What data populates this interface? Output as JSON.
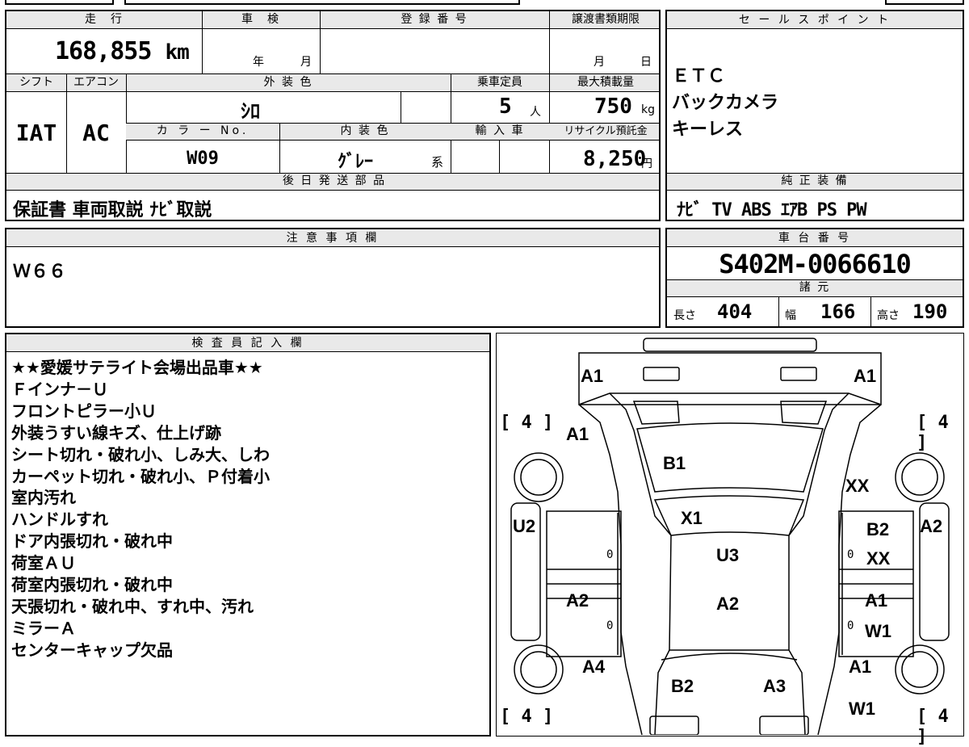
{
  "top_strip": {
    "title_fragment": ""
  },
  "mileage": {
    "label": "走　行",
    "value": "168,855",
    "unit": "km"
  },
  "shaken": {
    "label": "車　検",
    "year_unit": "年",
    "month_unit": "月"
  },
  "registration": {
    "label": "登 録 番 号"
  },
  "transfer_deadline": {
    "label": "譲渡書類期限",
    "month_unit": "月",
    "day_unit": "日"
  },
  "shift": {
    "label": "シフト",
    "value": "IAT"
  },
  "aircon": {
    "label": "エアコン",
    "value": "AC"
  },
  "exterior_color": {
    "label": "外 装 色",
    "value": "ｼﾛ"
  },
  "capacity": {
    "label": "乗車定員",
    "value": "5",
    "unit": "人"
  },
  "max_load": {
    "label": "最大積載量",
    "value": "750",
    "unit": "kg"
  },
  "color_no": {
    "label": "カ ラ ー No.",
    "value": "W09"
  },
  "interior_color": {
    "label": "内 装 色",
    "value": "ｸﾞﾚｰ",
    "suffix": "系"
  },
  "import": {
    "label": "輸 入 車"
  },
  "recycle": {
    "label": "リサイクル預託金",
    "value": "8,250",
    "unit": "円"
  },
  "later_parts": {
    "label": "後 日 発 送 部 品",
    "value": "保証書 車両取説 ﾅﾋﾞ取説"
  },
  "sale_points": {
    "label": "セ ー ル ス ポ イ ン ト",
    "items": [
      "ＥＴＣ",
      "バックカメラ",
      "キーレス"
    ]
  },
  "genuine_equipment": {
    "label": "純 正 装 備",
    "value": "ﾅﾋﾞ TV ABS ｴｱB PS PW"
  },
  "caution": {
    "label": "注 意 事 項 欄",
    "value": "Ｗ６６"
  },
  "chassis": {
    "label": "車 台 番 号",
    "value": "S402M-0066610"
  },
  "specs": {
    "label": "諸 元",
    "length_label": "長さ",
    "length": "404",
    "width_label": "幅",
    "width": "166",
    "height_label": "高さ",
    "height": "190"
  },
  "inspector": {
    "label": "検 査 員 記 入 欄",
    "lines": [
      "★★愛媛サテライト会場出品車★★",
      "Ｆインナ－Ｕ",
      "フロントピラー小Ｕ",
      "外装うすい線キズ、仕上げ跡",
      "シート切れ・破れ小、しみ大、しわ",
      "カーペット切れ・破れ小、Ｐ付着小",
      "室内汚れ",
      "ハンドルすれ",
      "ドア内張切れ・破れ中",
      "荷室ＡＵ",
      "荷室内張切れ・破れ中",
      "天張切れ・破れ中、すれ中、汚れ",
      "ミラーＡ",
      "センターキャップ欠品"
    ]
  },
  "diagram": {
    "codes": {
      "front_left": "A1",
      "front_right": "A1",
      "fender_left": "A1",
      "windshield": "B1",
      "fender_right": "XX",
      "pillar": "X1",
      "door_front_left": "U2",
      "roof": "U3",
      "door_front_right_a": "B2",
      "door_front_right_b": "XX",
      "mirror_right": "A2",
      "door_rear_left": "A2",
      "roof_rear": "A2",
      "door_rear_right_a": "A1",
      "door_rear_right_b": "W1",
      "rear_left": "A4",
      "tailgate_left": "B2",
      "tailgate_right": "A3",
      "quarter_right": "A1",
      "rear_right": "W1"
    },
    "tires": {
      "front_left": "4",
      "front_right": "4",
      "rear_left": "4",
      "rear_right": "4"
    },
    "zero": "0"
  },
  "colors": {
    "header_bg": "#e9e9e9",
    "border": "#000000"
  }
}
